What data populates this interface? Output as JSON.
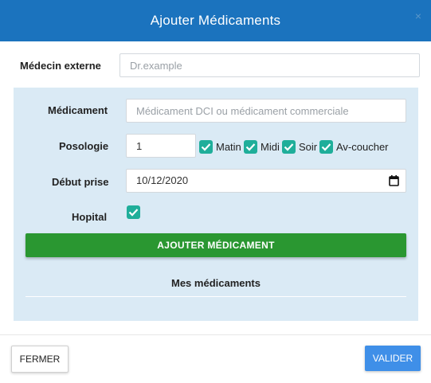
{
  "dialog": {
    "title": "Ajouter Médicaments",
    "close_glyph": "×"
  },
  "form": {
    "medecin_externe": {
      "label": "Médecin externe",
      "placeholder": "Dr.example"
    },
    "medicament": {
      "label": "Médicament",
      "placeholder": "Médicament DCI ou médicament commerciale"
    },
    "posologie": {
      "label": "Posologie",
      "value": "1",
      "options": [
        {
          "label": "Matin",
          "checked": true
        },
        {
          "label": "Midi",
          "checked": true
        },
        {
          "label": "Soir",
          "checked": true
        },
        {
          "label": "Av-coucher",
          "checked": true
        }
      ]
    },
    "debut_prise": {
      "label": "Début prise",
      "value": "10/12/2020"
    },
    "hopital": {
      "label": "Hopital",
      "checked": true
    },
    "add_button": "AJOUTER MÉDICAMENT",
    "list_title": "Mes médicaments"
  },
  "footer": {
    "close_button": "FERMER",
    "submit_button": "VALIDER"
  },
  "colors": {
    "header": "#1b73be",
    "panel": "#daeaf5",
    "checkbox": "#1fae9a",
    "add_button": "#2a9731",
    "submit_button": "#3f8fe8"
  }
}
